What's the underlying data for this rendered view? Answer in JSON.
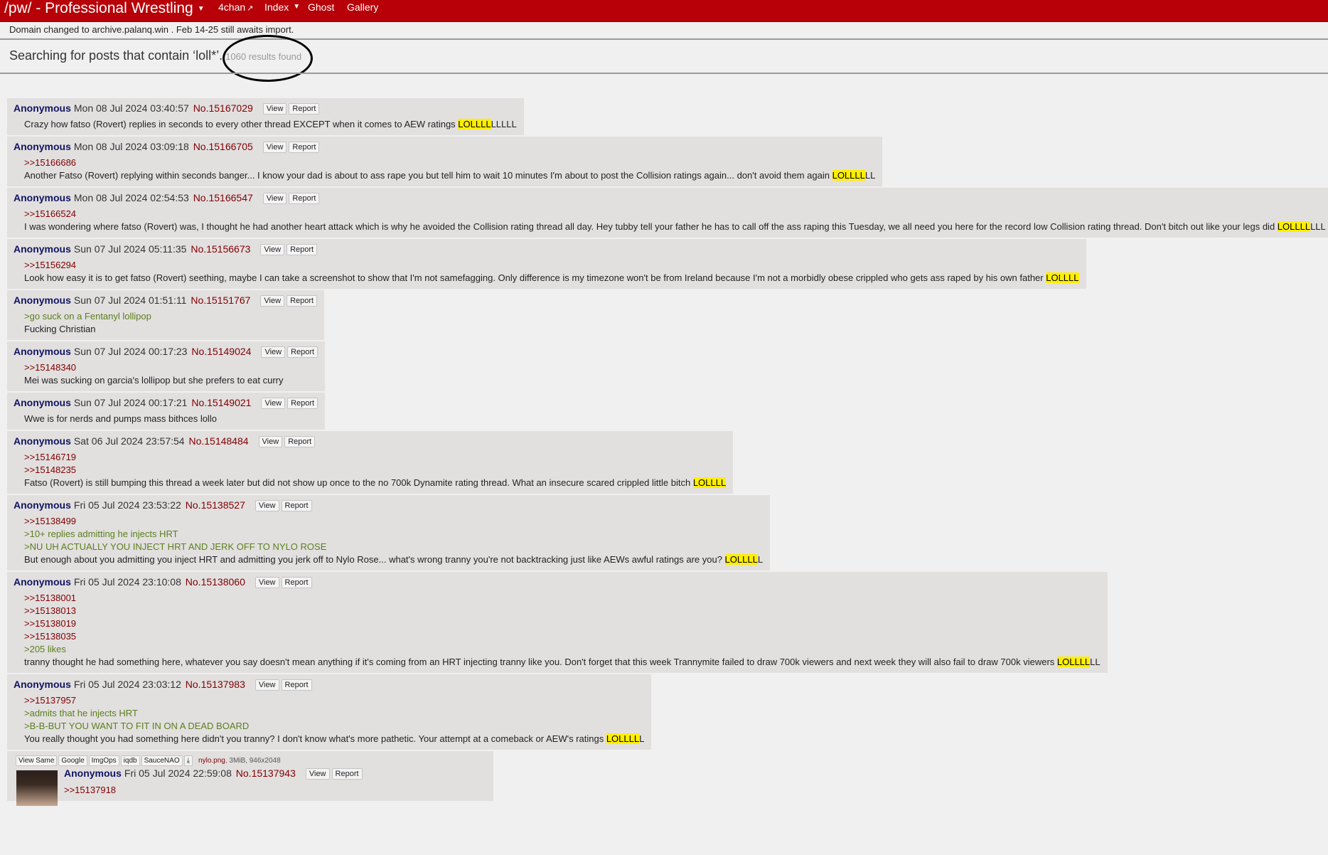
{
  "nav": {
    "board_title": "/pw/ - Professional Wrestling",
    "links": [
      "4chan",
      "Index",
      "Ghost",
      "Gallery"
    ]
  },
  "notice": "Domain changed to archive.palanq.win . Feb 14-25 still awaits import.",
  "search": {
    "prefix": "Searching for posts that contain ‘loll*’.",
    "results": "1060 results found"
  },
  "buttons": {
    "view": "View",
    "report": "Report"
  },
  "posts": [
    {
      "name": "Anonymous",
      "date": "Mon 08 Jul 2024 03:40:57",
      "no": "No.15167029",
      "lines": [
        [
          {
            "t": "Crazy how fatso (Rovert) replies in seconds to every other thread EXCEPT when it comes to AEW ratings "
          },
          {
            "t": "LOLLLL",
            "c": "hl"
          },
          {
            "t": "LLLLL"
          }
        ]
      ]
    },
    {
      "name": "Anonymous",
      "date": "Mon 08 Jul 2024 03:09:18",
      "no": "No.15166705",
      "lines": [
        [
          {
            "t": ">>15166686",
            "c": "ql"
          }
        ],
        [
          {
            "t": "Another Fatso (Rovert) replying within seconds banger... I know your dad is about to ass rape you but tell him to wait 10 minutes I'm about to post the Collision ratings again... don't avoid them again "
          },
          {
            "t": "LOLLLL",
            "c": "hl"
          },
          {
            "t": "LL"
          }
        ]
      ]
    },
    {
      "name": "Anonymous",
      "date": "Mon 08 Jul 2024 02:54:53",
      "no": "No.15166547",
      "lines": [
        [
          {
            "t": ">>15166524",
            "c": "ql"
          }
        ],
        [
          {
            "t": "I was wondering where fatso (Rovert) was, I thought he had another heart attack which is why he avoided the Collision rating thread all day. Hey tubby tell your father he has to call off the ass raping this Tuesday, we all need you here for the record low Collision rating thread. Don't bitch out like your legs did "
          },
          {
            "t": "LOLLLL",
            "c": "hl"
          },
          {
            "t": "LLL"
          }
        ]
      ]
    },
    {
      "name": "Anonymous",
      "date": "Sun 07 Jul 2024 05:11:35",
      "no": "No.15156673",
      "lines": [
        [
          {
            "t": ">>15156294",
            "c": "ql"
          }
        ],
        [
          {
            "t": "Look how easy it is to get fatso (Rovert) seething, maybe I can take a screenshot to show that I'm not samefagging. Only difference is my timezone won't be from Ireland because I'm not a morbidly obese crippled who gets ass raped by his own father "
          },
          {
            "t": "LOLLLL",
            "c": "hl"
          }
        ]
      ]
    },
    {
      "name": "Anonymous",
      "date": "Sun 07 Jul 2024 01:51:11",
      "no": "No.15151767",
      "lines": [
        [
          {
            "t": ">go suck on a Fentanyl lollipop",
            "c": "gt"
          }
        ],
        [
          {
            "t": "Fucking Christian"
          }
        ]
      ]
    },
    {
      "name": "Anonymous",
      "date": "Sun 07 Jul 2024 00:17:23",
      "no": "No.15149024",
      "lines": [
        [
          {
            "t": ">>15148340",
            "c": "ql"
          }
        ],
        [
          {
            "t": "Mei was sucking on garcia's lollipop but she prefers to eat curry"
          }
        ]
      ]
    },
    {
      "name": "Anonymous",
      "date": "Sun 07 Jul 2024 00:17:21",
      "no": "No.15149021",
      "lines": [
        [
          {
            "t": "Wwe is for nerds and pumps mass bithces lollo"
          }
        ]
      ]
    },
    {
      "name": "Anonymous",
      "date": "Sat 06 Jul 2024 23:57:54",
      "no": "No.15148484",
      "lines": [
        [
          {
            "t": ">>15146719",
            "c": "ql"
          }
        ],
        [
          {
            "t": ">>15148235",
            "c": "ql"
          }
        ],
        [
          {
            "t": "Fatso (Rovert) is still bumping this thread a week later but did not show up once to the no 700k Dynamite rating thread. What an insecure scared crippled little bitch "
          },
          {
            "t": "LOLLLL",
            "c": "hl"
          }
        ]
      ]
    },
    {
      "name": "Anonymous",
      "date": "Fri 05 Jul 2024 23:53:22",
      "no": "No.15138527",
      "lines": [
        [
          {
            "t": ">>15138499",
            "c": "ql"
          }
        ],
        [
          {
            "t": ">10+ replies admitting he injects HRT",
            "c": "gt"
          }
        ],
        [
          {
            "t": ">NU UH ACTUALLY YOU INJECT HRT AND JERK OFF TO NYLO ROSE",
            "c": "gt"
          }
        ],
        [
          {
            "t": "But enough about you admitting you inject HRT and admitting you jerk off to Nylo Rose... what's wrong tranny you're not backtracking just like AEWs awful ratings are you? "
          },
          {
            "t": "LOLLLL",
            "c": "hl"
          },
          {
            "t": "L"
          }
        ]
      ]
    },
    {
      "name": "Anonymous",
      "date": "Fri 05 Jul 2024 23:10:08",
      "no": "No.15138060",
      "lines": [
        [
          {
            "t": ">>15138001",
            "c": "ql"
          }
        ],
        [
          {
            "t": ">>15138013",
            "c": "ql"
          }
        ],
        [
          {
            "t": ">>15138019",
            "c": "ql"
          }
        ],
        [
          {
            "t": ">>15138035",
            "c": "ql"
          }
        ],
        [
          {
            "t": ">205 likes",
            "c": "gt"
          }
        ],
        [
          {
            "t": "tranny thought he had something here, whatever you say doesn't mean anything if it's coming from an HRT injecting tranny like you. Don't forget that this week Trannymite failed to draw 700k viewers and next week they will also fail to draw 700k viewers "
          },
          {
            "t": "LOLLLL",
            "c": "hl"
          },
          {
            "t": "LL"
          }
        ]
      ]
    },
    {
      "name": "Anonymous",
      "date": "Fri 05 Jul 2024 23:03:12",
      "no": "No.15137983",
      "lines": [
        [
          {
            "t": ">>15137957",
            "c": "ql"
          }
        ],
        [
          {
            "t": ">admits that he injects HRT",
            "c": "gt"
          }
        ],
        [
          {
            "t": ">B-B-BUT YOU WANT TO FIT IN ON A DEAD BOARD",
            "c": "gt"
          }
        ],
        [
          {
            "t": "You really thought you had something here didn't you tranny? I don't know what's more pathetic. Your attempt at a comeback or AEW's ratings "
          },
          {
            "t": "LOLLLL",
            "c": "hl"
          },
          {
            "t": "L"
          }
        ]
      ]
    }
  ],
  "image_post": {
    "tools": [
      "View Same",
      "Google",
      "ImgOps",
      "iqdb",
      "SauceNAO",
      "⤓"
    ],
    "filename": "nylo.png",
    "fileinfo": ", 3MiB, 946x2048",
    "name": "Anonymous",
    "date": "Fri 05 Jul 2024 22:59:08",
    "no": "No.15137943",
    "quote": ">>15137918"
  }
}
